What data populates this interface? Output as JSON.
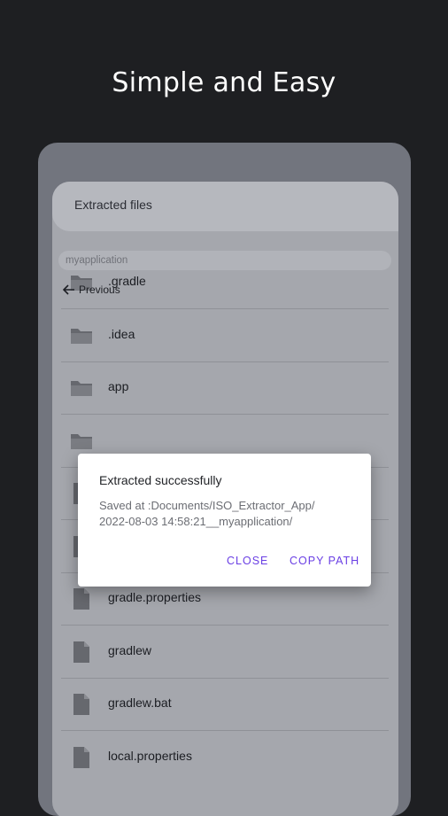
{
  "headline": "Simple and Easy",
  "app": {
    "title": "Extracted files",
    "current_folder": "myapplication",
    "previous_label": "Previous"
  },
  "files": [
    {
      "name": ".gradle",
      "type": "folder"
    },
    {
      "name": ".idea",
      "type": "folder"
    },
    {
      "name": "app",
      "type": "folder"
    },
    {
      "name": "",
      "type": "folder"
    },
    {
      "name": "",
      "type": "file"
    },
    {
      "name": "",
      "type": "file"
    },
    {
      "name": "gradle.properties",
      "type": "file"
    },
    {
      "name": "gradlew",
      "type": "file"
    },
    {
      "name": "gradlew.bat",
      "type": "file"
    },
    {
      "name": "local.properties",
      "type": "file"
    }
  ],
  "dialog": {
    "title": "Extracted successfully",
    "message_line1": "Saved at :Documents/ISO_Extractor_App/",
    "message_line2": "2022-08-03 14:58:21__myapplication/",
    "close_label": "CLOSE",
    "copy_label": "COPY PATH"
  },
  "colors": {
    "background": "#1e1f22",
    "accent": "#6a3fe4",
    "icon": "#66686e"
  }
}
